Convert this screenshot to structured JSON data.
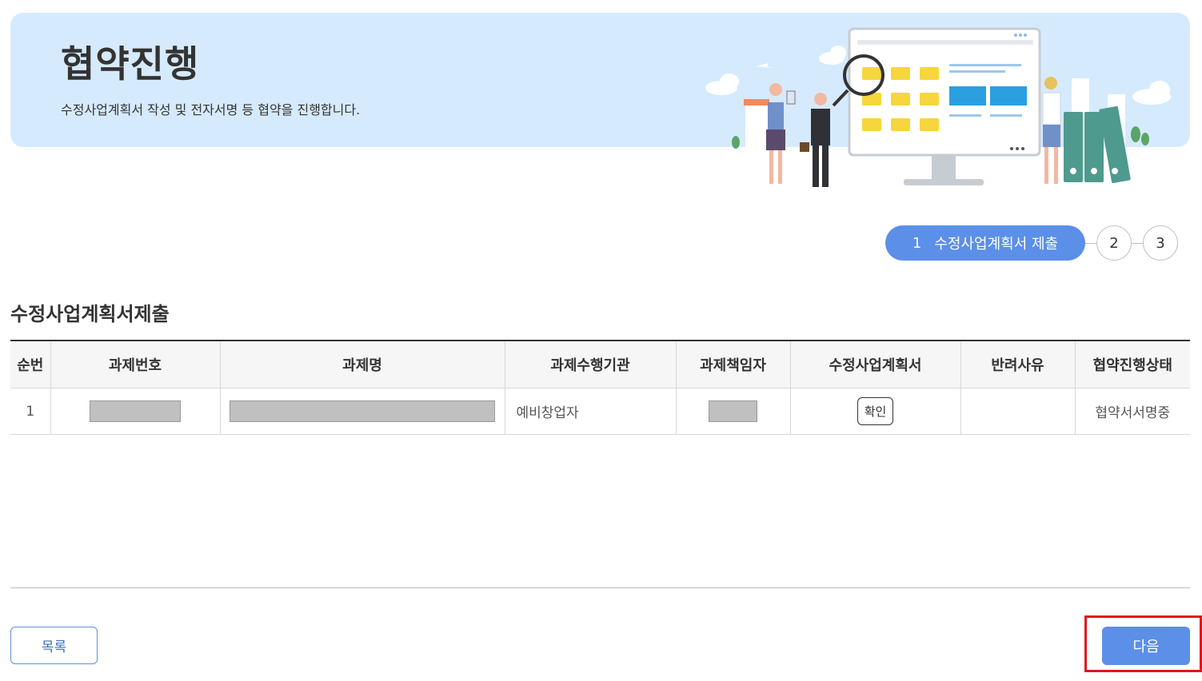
{
  "banner": {
    "title": "협약진행",
    "description": "수정사업계획서 작성 및 전자서명 등 협약을 진행합니다."
  },
  "steps": {
    "active": {
      "number": "1",
      "label": "수정사업계획서 제출"
    },
    "others": [
      "2",
      "3"
    ]
  },
  "section": {
    "title": "수정사업계획서제출"
  },
  "table": {
    "headers": [
      "순번",
      "과제번호",
      "과제명",
      "과제수행기관",
      "과제책임자",
      "수정사업계획서",
      "반려사유",
      "협약진행상태"
    ],
    "rows": [
      {
        "index": "1",
        "task_number": "",
        "task_name": "",
        "organization": "예비창업자",
        "manager": "",
        "plan_button": "확인",
        "reject_reason": "",
        "status": "협약서서명중"
      }
    ]
  },
  "buttons": {
    "list": "목록",
    "next": "다음"
  },
  "colors": {
    "accent": "#5b8fe8",
    "banner_bg": "#d6eafd",
    "highlight": "#e0161b"
  }
}
